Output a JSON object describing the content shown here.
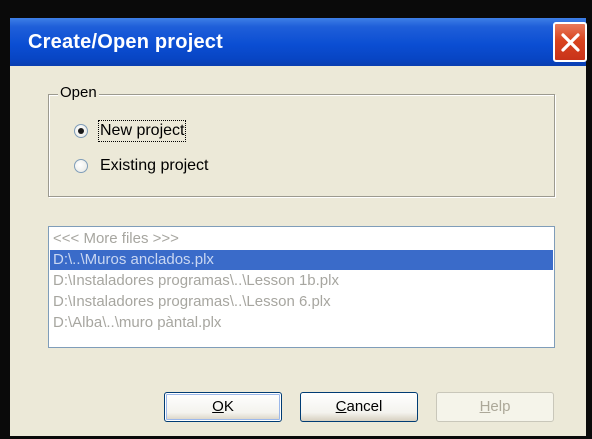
{
  "window": {
    "title": "Create/Open project",
    "accent": "#0b4ed3",
    "close_icon": "close-x-icon"
  },
  "open_group": {
    "label": "Open",
    "options": [
      {
        "label": "New project",
        "checked": true
      },
      {
        "label": "Existing project",
        "checked": false
      }
    ]
  },
  "recent_files": {
    "items": [
      {
        "text": "<<< More files >>>",
        "selected": false
      },
      {
        "text": "D:\\..\\Muros anclados.plx",
        "selected": true
      },
      {
        "text": "D:\\Instaladores programas\\..\\Lesson 1b.plx",
        "selected": false
      },
      {
        "text": "D:\\Instaladores programas\\..\\Lesson 6.plx",
        "selected": false
      },
      {
        "text": "D:\\Alba\\..\\muro pàntal.plx",
        "selected": false
      }
    ]
  },
  "buttons": {
    "ok": {
      "mnemonic": "O",
      "rest": "K",
      "enabled": true
    },
    "cancel": {
      "mnemonic": "C",
      "rest": "ancel",
      "enabled": true
    },
    "help": {
      "mnemonic": "H",
      "rest": "elp",
      "enabled": false
    }
  }
}
